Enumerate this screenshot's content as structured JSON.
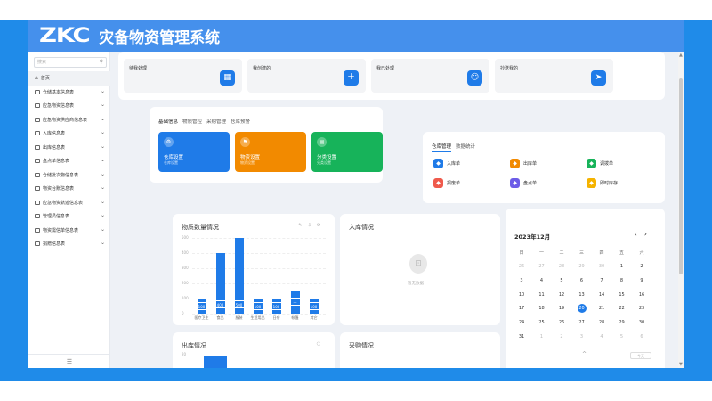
{
  "app": {
    "logo": "ZKC",
    "title": "灾备物资管理系统"
  },
  "sidebar": {
    "search_placeholder": "搜索",
    "items": [
      {
        "label": "首页"
      },
      {
        "label": "仓储基本信息表"
      },
      {
        "label": "应急物资信息表"
      },
      {
        "label": "应急物资供应商信息表"
      },
      {
        "label": "入库信息表"
      },
      {
        "label": "出库信息表"
      },
      {
        "label": "盘点单信息表"
      },
      {
        "label": "仓储批次物信息表"
      },
      {
        "label": "物资台账信息表"
      },
      {
        "label": "应急物资轨迹信息表"
      },
      {
        "label": "管理员信息表"
      },
      {
        "label": "物资需信单信息表"
      },
      {
        "label": "捐赠信息表"
      }
    ]
  },
  "todos": [
    {
      "label": "待我处理",
      "icon": "▦"
    },
    {
      "label": "我创建的",
      "icon": "＋"
    },
    {
      "label": "我已处理",
      "icon": "☺"
    },
    {
      "label": "抄送我的",
      "icon": "➤"
    }
  ],
  "quick": {
    "tabs": [
      "基础信息",
      "物质管控",
      "采购管理",
      "仓库预警"
    ],
    "tiles": [
      {
        "title": "仓库设置",
        "sub": "仓库设置",
        "color": "#1f7be8",
        "icon": "⚙"
      },
      {
        "title": "物资设置",
        "sub": "物资设置",
        "color": "#f28a00",
        "icon": "⚑"
      },
      {
        "title": "分类设置",
        "sub": "分类设置",
        "color": "#17b35a",
        "icon": "▤"
      }
    ]
  },
  "warehouse": {
    "tabs": [
      "仓库管理",
      "数据统计"
    ],
    "items": [
      {
        "label": "入库单",
        "color": "#1f7be8",
        "icon": "◆"
      },
      {
        "label": "出库单",
        "color": "#f28a00",
        "icon": "◆"
      },
      {
        "label": "调拨单",
        "color": "#17b35a",
        "icon": "◆"
      },
      {
        "label": "报废单",
        "color": "#ef5a4c",
        "icon": "◆"
      },
      {
        "label": "盘点单",
        "color": "#6c5ce7",
        "icon": "◆"
      },
      {
        "label": "即时库存",
        "color": "#f5b300",
        "icon": "◆"
      }
    ]
  },
  "panels": {
    "material": "物质数量情况",
    "inbound": "入库情况",
    "outbound": "出库情况",
    "purchase": "采购情况",
    "empty": "暂无数据"
  },
  "chart_data": {
    "type": "bar",
    "title": "物质数量情况",
    "categories": [
      "医疗卫生",
      "食品",
      "服装",
      "生活用品",
      "日杂",
      "帐篷",
      "其它"
    ],
    "values": [
      100,
      400,
      500,
      100,
      100,
      150,
      100
    ],
    "data_labels": [
      "100",
      "400",
      "500",
      "100",
      "100",
      "—",
      "100"
    ],
    "yticks": [
      0,
      100,
      200,
      300,
      400,
      500
    ],
    "ylim": [
      0,
      500
    ]
  },
  "calendar": {
    "title": "2023年12月",
    "prev": "‹",
    "next": "›",
    "weekdays": [
      "日",
      "一",
      "二",
      "三",
      "四",
      "五",
      "六"
    ],
    "weeks": [
      [
        "26",
        "27",
        "28",
        "29",
        "30",
        "1",
        "2"
      ],
      [
        "3",
        "4",
        "5",
        "6",
        "7",
        "8",
        "9"
      ],
      [
        "10",
        "11",
        "12",
        "13",
        "14",
        "15",
        "16"
      ],
      [
        "17",
        "18",
        "19",
        "20",
        "21",
        "22",
        "23"
      ],
      [
        "24",
        "25",
        "26",
        "27",
        "28",
        "29",
        "30"
      ],
      [
        "31",
        "1",
        "2",
        "3",
        "4",
        "5",
        "6"
      ]
    ],
    "today": "20",
    "collapse_icon": "^",
    "today_button": "今天"
  },
  "outbound_chart": {
    "yticks": [
      "20"
    ],
    "values": [
      20
    ]
  }
}
